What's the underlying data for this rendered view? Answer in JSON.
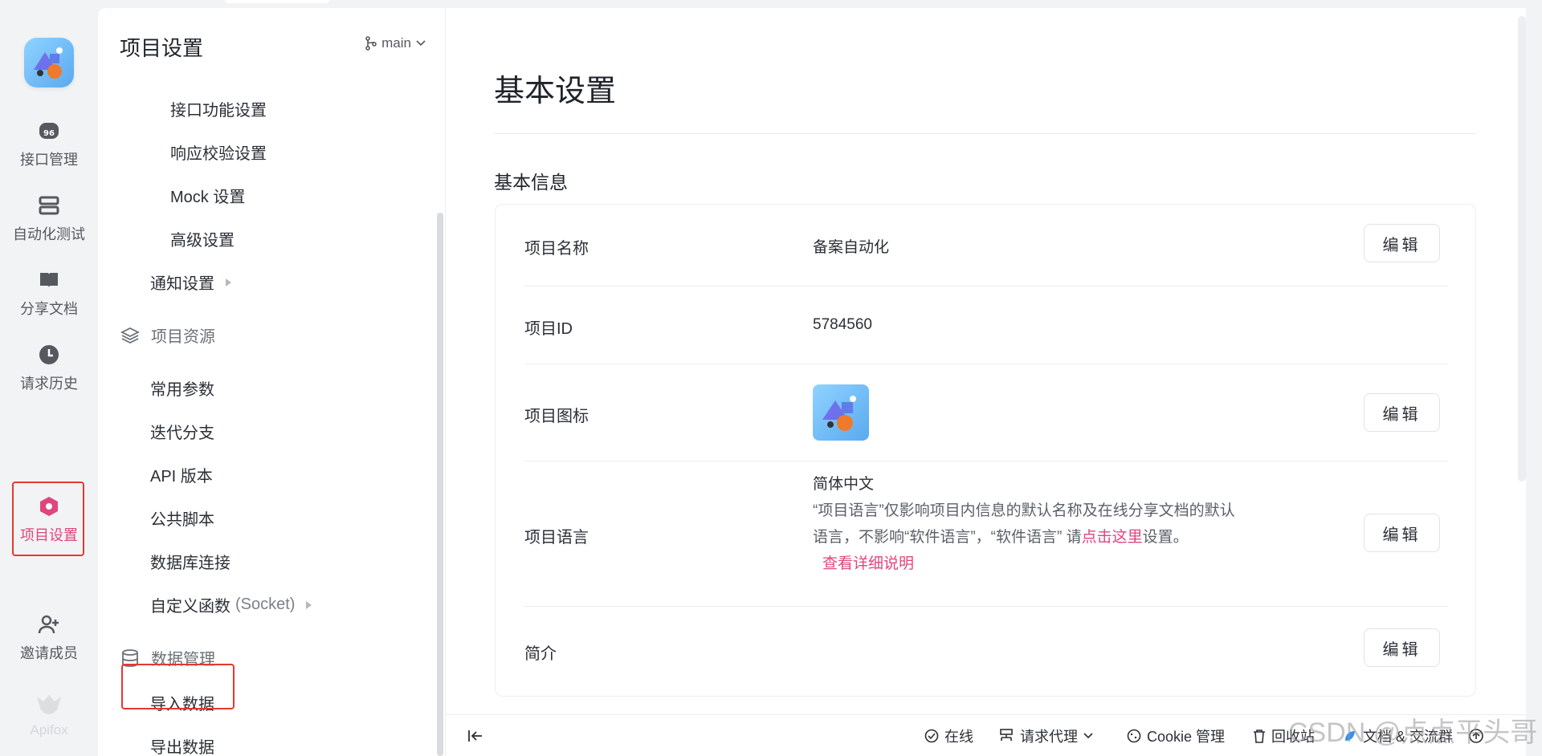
{
  "rail": {
    "items": [
      {
        "label": "接口管理",
        "icon": "api-icon"
      },
      {
        "label": "自动化测试",
        "icon": "automation-icon"
      },
      {
        "label": "分享文档",
        "icon": "book-icon"
      },
      {
        "label": "请求历史",
        "icon": "clock-icon"
      },
      {
        "label": "项目设置",
        "icon": "settings-hex-icon",
        "active": true
      },
      {
        "label": "邀请成员",
        "icon": "add-user-icon"
      },
      {
        "label": "Apifox",
        "icon": "apifox-logo"
      }
    ],
    "active_color": "#e0467c"
  },
  "nav": {
    "title": "项目设置",
    "branch": "main",
    "items": [
      "接口功能设置",
      "响应校验设置",
      "Mock 设置",
      "高级设置",
      "通知设置"
    ],
    "resources_group": "项目资源",
    "resources": [
      "常用参数",
      "迭代分支",
      "API 版本",
      "公共脚本",
      "数据库连接",
      "自定义函数"
    ],
    "custom_func_suffix": "(Socket)",
    "data_group": "数据管理",
    "data_items": [
      "导入数据",
      "导出数据"
    ]
  },
  "main": {
    "title": "基本设置",
    "section": "基本信息",
    "edit_label": "编辑",
    "rows": {
      "name_label": "项目名称",
      "name_value": "备案自动化",
      "id_label": "项目ID",
      "id_value": "5784560",
      "icon_label": "项目图标",
      "lang_label": "项目语言",
      "lang_value": "简体中文",
      "lang_desc_1": "“项目语言”仅影响项目内信息的默认名称及在线分享文档的默认",
      "lang_desc_2a": "语言，不影响“软件语言”，“软件语言” 请",
      "lang_desc_link": "点击这里",
      "lang_desc_2b": "设置。",
      "lang_detail_link": "查看详细说明",
      "intro_label": "简介"
    }
  },
  "statusbar": {
    "online": "在线",
    "proxy": "请求代理",
    "cookie": "Cookie 管理",
    "recycle": "回收站",
    "docs": "文档 & 交流群"
  },
  "watermark": "CSDN @点点平头哥"
}
